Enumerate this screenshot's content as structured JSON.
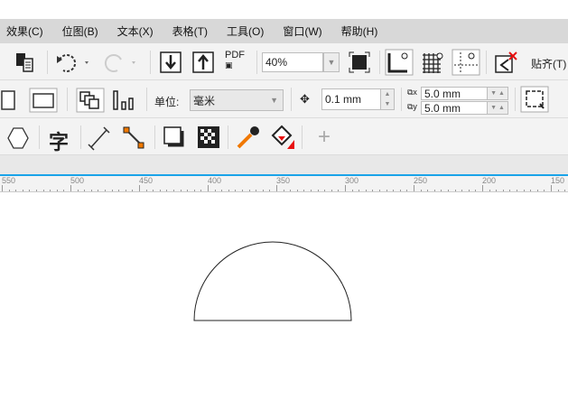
{
  "menu": [
    "效果(C)",
    "位图(B)",
    "文本(X)",
    "表格(T)",
    "工具(O)",
    "窗口(W)",
    "帮助(H)"
  ],
  "toolbar": {
    "pdf_label": "PDF",
    "zoom_value": "40%",
    "snap_label": "贴齐(T)"
  },
  "property_bar": {
    "unit_label": "单位:",
    "unit_value": "毫米",
    "nudge_value": "0.1 mm",
    "dup_x": "5.0 mm",
    "dup_y": "5.0 mm"
  },
  "ruler": {
    "labels": [
      "550",
      "500",
      "450",
      "400",
      "350",
      "300",
      "250",
      "200",
      "150"
    ]
  },
  "colors": {
    "accent": "#1aa3e8",
    "orange": "#f07800",
    "red": "#e81010"
  }
}
